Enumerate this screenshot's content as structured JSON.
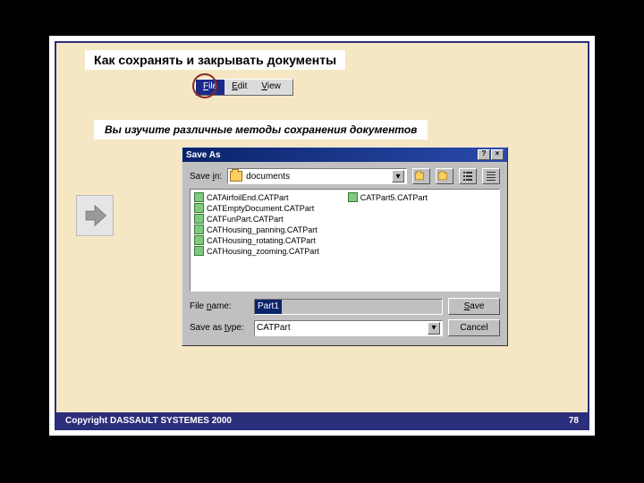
{
  "title": "Как сохранять и закрывать документы",
  "subtitle": "Вы изучите различные методы сохранения документов",
  "menu": {
    "file": "File",
    "edit": "Edit",
    "view": "View"
  },
  "dialog": {
    "title": "Save As",
    "savein_label": "Save in:",
    "savein_value": "documents",
    "files_col1": [
      "CATAirfoilEnd.CATPart",
      "CATEmptyDocument.CATPart",
      "CATFunPart.CATPart",
      "CATHousing_panning.CATPart",
      "CATHousing_rotating.CATPart",
      "CATHousing_zooming.CATPart"
    ],
    "files_col2": [
      "CATPart5.CATPart"
    ],
    "filename_label": "File name:",
    "filename_value": "Part1",
    "savetype_label": "Save as type:",
    "savetype_value": "CATPart",
    "save_btn": "Save",
    "cancel_btn": "Cancel"
  },
  "footer": {
    "copyright": "Copyright DASSAULT SYSTEMES 2000",
    "page": "78"
  }
}
